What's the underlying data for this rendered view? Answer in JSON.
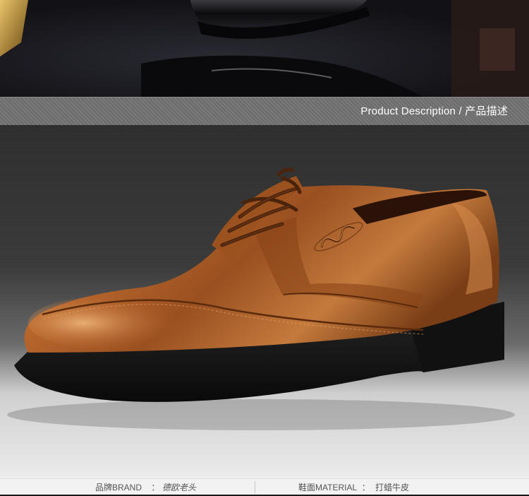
{
  "banner": {
    "title": "Product Description / 产品描述"
  },
  "specs": {
    "brand_label": "品牌BRAND",
    "brand_sep": "：",
    "brand_value": "德欧老头",
    "material_label": "鞋面MATERIAL",
    "material_sep": "：",
    "material_value": "打蜡牛皮"
  },
  "colors": {
    "leather": "#a65a25",
    "leather_highlight": "#e0a167",
    "sole": "#141414",
    "banner": "#707070"
  }
}
